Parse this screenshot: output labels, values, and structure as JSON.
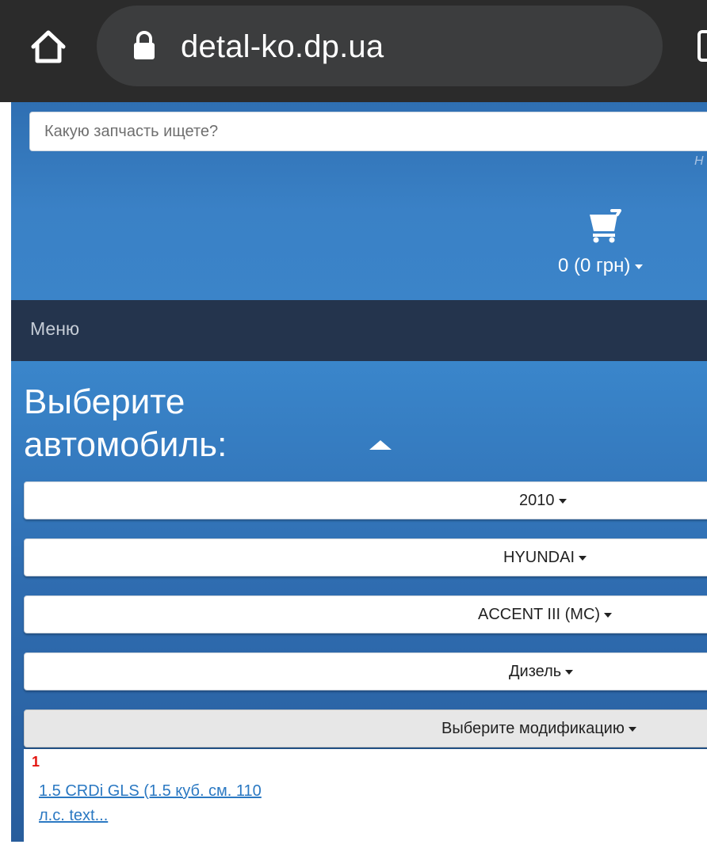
{
  "browser": {
    "url": "detal-ko.dp.ua",
    "icons": {
      "home": "home-icon",
      "lock": "lock-icon",
      "tabs": "tabs-icon"
    }
  },
  "header": {
    "search_placeholder": "Какую запчасть ищете?",
    "search_hint_fragment": "Н",
    "cart": {
      "icon": "cart-icon",
      "total": "0 (0 грн)"
    }
  },
  "menu": {
    "label": "Меню"
  },
  "car_selector": {
    "title": "Выберите автомобиль:",
    "year": "2010",
    "brand": "HYUNDAI",
    "model": "ACCENT III (MC)",
    "fuel": "Дизель",
    "modification": "Выберите модификацию",
    "modifications": [
      {
        "number": "1",
        "label": "1.5 CRDi GLS (1.5 куб. см. 110 л.с. text..."
      }
    ]
  },
  "colors": {
    "header_blue": "#3a81c6",
    "menu_dark": "#24344d",
    "link_blue": "#2a78c2",
    "number_red": "#e3140f"
  }
}
